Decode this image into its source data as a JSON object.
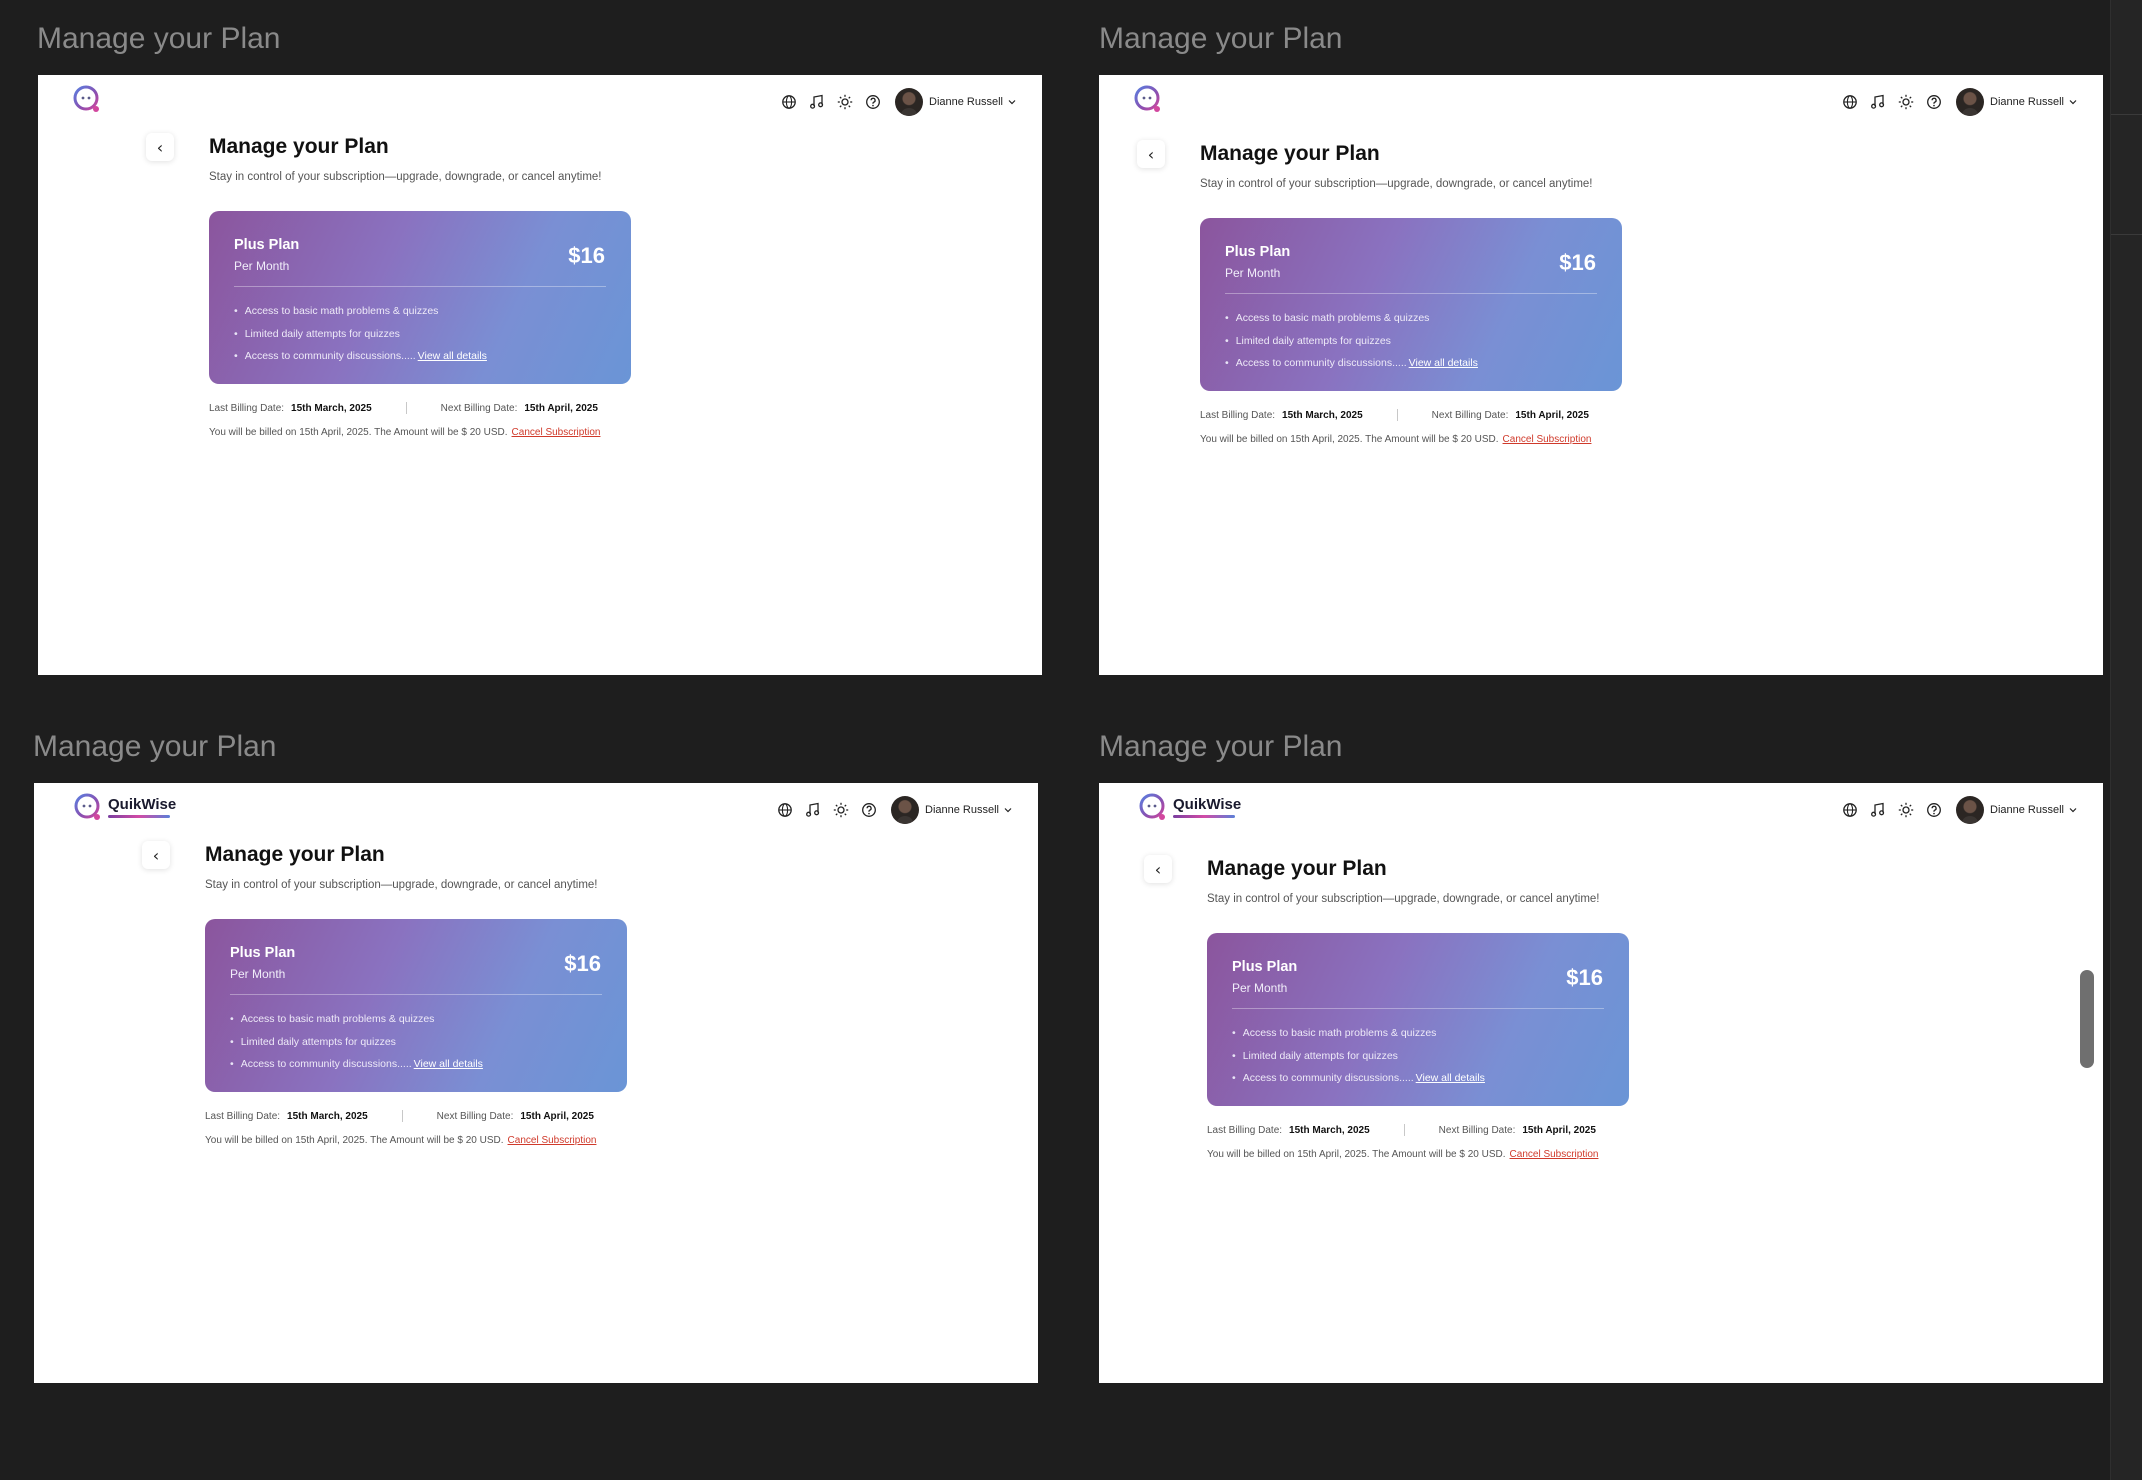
{
  "frame_label": "Manage your Plan",
  "app": {
    "brand": "QuikWise",
    "user_name": "Dianne Russell"
  },
  "page": {
    "title": "Manage your Plan",
    "subtitle": "Stay in control of your subscription—upgrade, downgrade, or cancel anytime!"
  },
  "plan": {
    "name": "Plus Plan",
    "period": "Per Month",
    "price": "$16",
    "features": [
      "Access to basic math problems & quizzes",
      "Limited daily attempts for quizzes",
      "Access to community discussions....."
    ],
    "view_all": "View all details"
  },
  "billing": {
    "last_label": "Last Billing Date:",
    "last_value": "15th March, 2025",
    "next_label": "Next Billing Date:",
    "next_value": "15th April, 2025",
    "note": "You will be billed on 15th April, 2025. The Amount will be $ 20 USD.",
    "cancel": "Cancel Subscription"
  },
  "icons": [
    "globe-icon",
    "music-icon",
    "sun-icon",
    "help-icon",
    "chevron-down-icon",
    "back-chevron-icon"
  ]
}
